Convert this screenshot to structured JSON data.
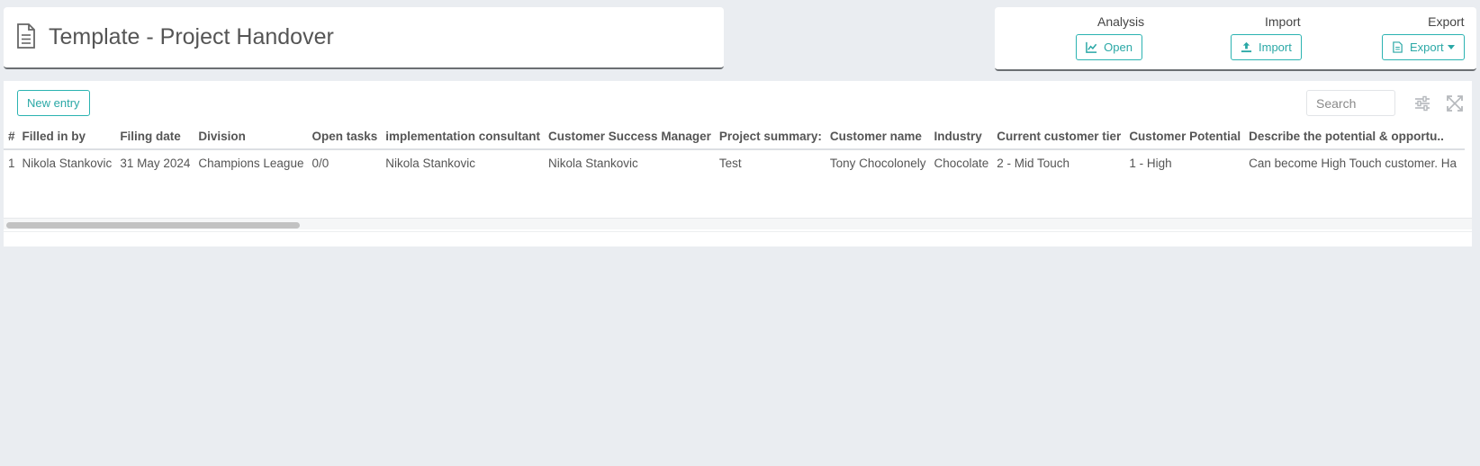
{
  "header": {
    "title": "Template - Project Handover"
  },
  "actions": {
    "analysis": {
      "label": "Analysis",
      "button": "Open"
    },
    "import": {
      "label": "Import",
      "button": "Import"
    },
    "export": {
      "label": "Export",
      "button": "Export"
    }
  },
  "toolbar": {
    "new_entry": "New entry",
    "search_placeholder": "Search"
  },
  "table": {
    "columns": [
      "#",
      "Filled in by",
      "Filing date",
      "Division",
      "Open tasks",
      "implementation consultant",
      "Customer Success Manager",
      "Project summary:",
      "Customer name",
      "Industry",
      "Current customer tier",
      "Customer Potential",
      "Describe the potential & opportu.."
    ],
    "rows": [
      [
        "1",
        "Nikola Stankovic",
        "31 May 2024",
        "Champions League",
        "0/0",
        "Nikola Stankovic",
        "Nikola Stankovic",
        "Test",
        "Tony Chocolonely",
        "Chocolate",
        "2 - Mid Touch",
        "1 - High",
        "Can become High Touch customer. Ha"
      ]
    ]
  },
  "colors": {
    "accent": "#2aa8a6",
    "background": "#eaedf1",
    "text": "#555555"
  }
}
